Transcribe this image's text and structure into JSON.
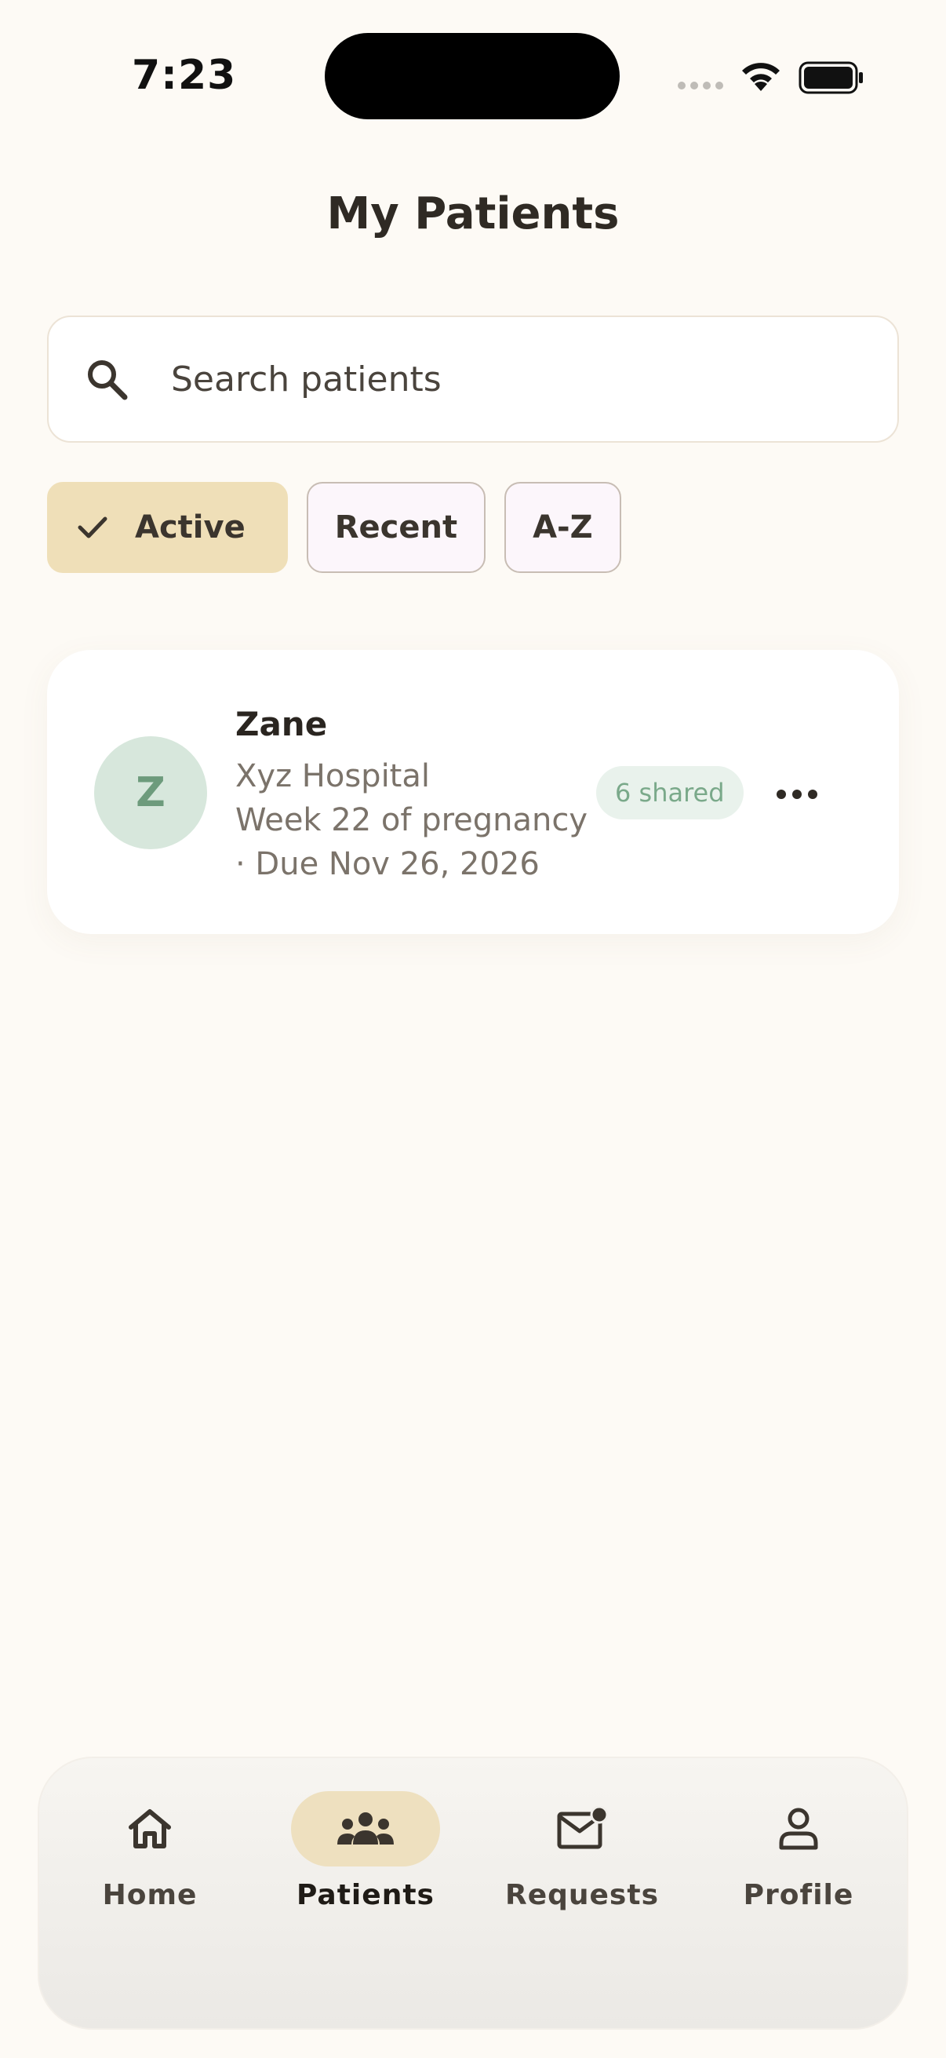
{
  "status_bar": {
    "time": "7:23"
  },
  "header": {
    "title": "My Patients"
  },
  "search": {
    "placeholder": "Search patients",
    "value": ""
  },
  "filters": [
    {
      "label": "Active",
      "selected": true
    },
    {
      "label": "Recent",
      "selected": false
    },
    {
      "label": "A-Z",
      "selected": false
    }
  ],
  "patients": [
    {
      "initial": "Z",
      "name": "Zane",
      "hospital": "Xyz Hospital",
      "pregnancy": "Week 22 of pregnancy",
      "due": "· Due Nov 26, 2026",
      "shared": "6 shared"
    }
  ],
  "bottom_nav": {
    "items": [
      {
        "label": "Home",
        "icon": "home-icon",
        "active": false
      },
      {
        "label": "Patients",
        "icon": "group-icon",
        "active": true
      },
      {
        "label": "Requests",
        "icon": "mail-badge-icon",
        "active": false
      },
      {
        "label": "Profile",
        "icon": "person-icon",
        "active": false
      }
    ]
  },
  "colors": {
    "background": "#fdfaf5",
    "accent": "#efdfb8",
    "avatar_bg": "#d7e7dc",
    "avatar_text": "#6d9b7c",
    "badge_bg": "#e9f2ec",
    "badge_text": "#7aa98a"
  }
}
